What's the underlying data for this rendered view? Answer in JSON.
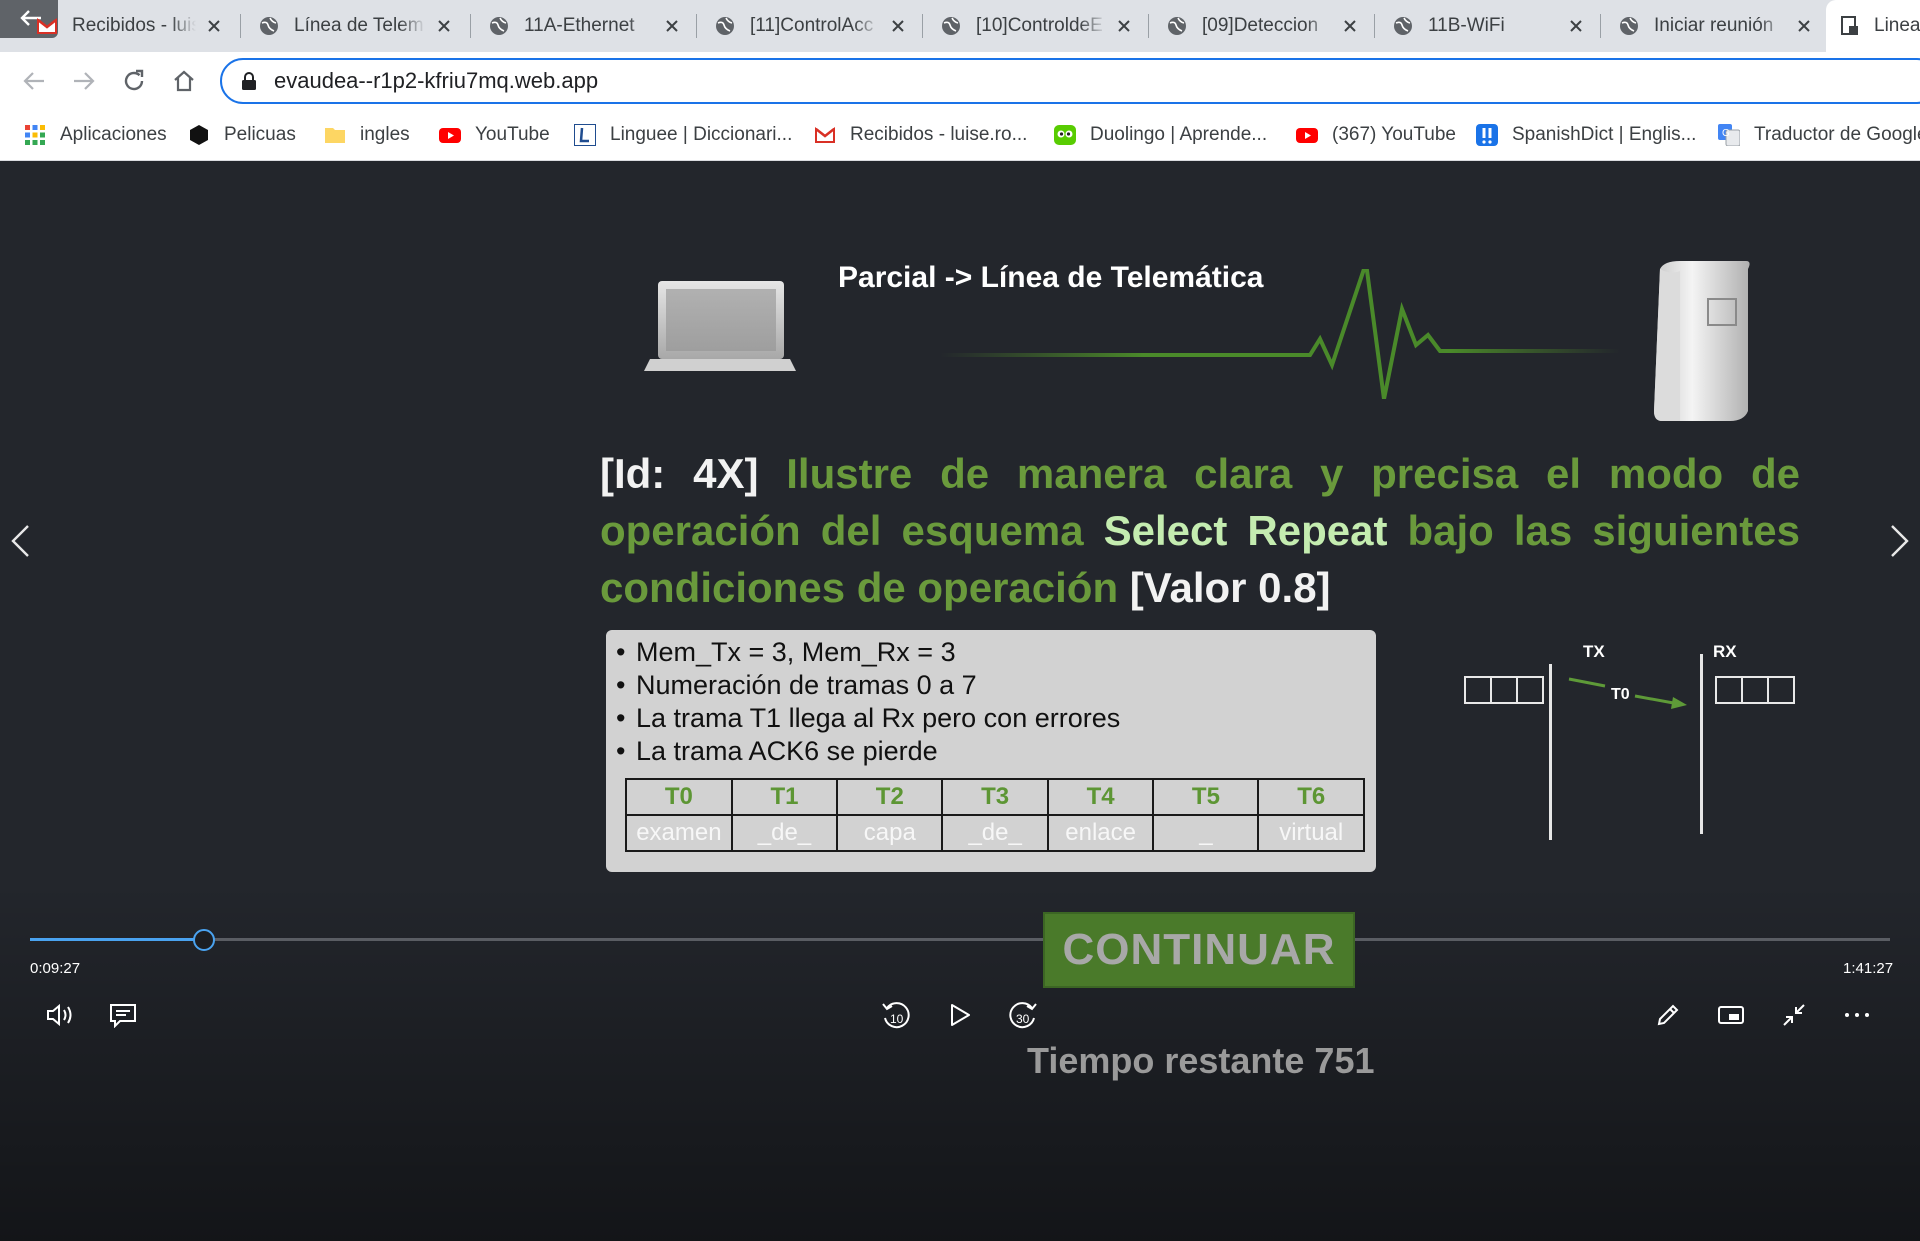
{
  "browser": {
    "tabs": [
      {
        "title": "Recibidos - luis",
        "icon": "gmail-icon"
      },
      {
        "title": "Línea de Telem",
        "icon": "globe-icon"
      },
      {
        "title": "11A-Ethernet",
        "icon": "globe-icon"
      },
      {
        "title": "[11]ControlAcc",
        "icon": "globe-icon"
      },
      {
        "title": "[10]ControldeE",
        "icon": "globe-icon"
      },
      {
        "title": "[09]Deteccion",
        "icon": "globe-icon"
      },
      {
        "title": "11B-WiFi",
        "icon": "globe-icon"
      },
      {
        "title": "Iniciar reunión",
        "icon": "globe-icon"
      },
      {
        "title": "Linea",
        "icon": "page-icon"
      }
    ],
    "url": "evaudea--r1p2-kfriu7mq.web.app",
    "bookmarks": [
      {
        "label": "Aplicaciones",
        "icon": "apps-grid-icon"
      },
      {
        "label": "Pelicuas",
        "icon": "hexagon-icon"
      },
      {
        "label": "ingles",
        "icon": "folder-icon"
      },
      {
        "label": "YouTube",
        "icon": "youtube-icon"
      },
      {
        "label": "Linguee | Diccionari...",
        "icon": "linguee-icon"
      },
      {
        "label": "Recibidos - luise.ro...",
        "icon": "gmail-icon"
      },
      {
        "label": "Duolingo | Aprende...",
        "icon": "duolingo-icon"
      },
      {
        "label": "(367) YouTube",
        "icon": "youtube-icon"
      },
      {
        "label": "SpanishDict | Englis...",
        "icon": "spanishdict-icon"
      },
      {
        "label": "Traductor de Google",
        "icon": "google-translate-icon"
      }
    ]
  },
  "slide": {
    "header_title": "Parcial -> Línea de Telemática",
    "question": {
      "id": "[Id: 4X]",
      "text_a": "Ilustre de manera clara y precisa el modo de operación del esquema",
      "highlight": "Select Repeat",
      "text_b": "bajo las siguientes condiciones de operación",
      "value": "[Valor 0.8]"
    },
    "conditions": [
      "Mem_Tx = 3, Mem_Rx = 3",
      "Numeración de tramas 0 a 7",
      "La trama T1 llega al Rx pero con errores",
      "La trama ACK6 se pierde"
    ],
    "frames_table": {
      "headers": [
        "T0",
        "T1",
        "T2",
        "T3",
        "T4",
        "T5",
        "T6"
      ],
      "values": [
        "examen",
        "_de_",
        "capa",
        "_de_",
        "enlace",
        "_",
        "virtual"
      ]
    },
    "diagram": {
      "tx_label": "TX",
      "rx_label": "RX",
      "frame_label": "T0"
    },
    "continue_label": "CONTINUAR",
    "remaining_label": "Tiempo restante 751"
  },
  "player": {
    "current_time": "0:09:27",
    "total_time": "1:41:27",
    "progress_fraction": 0.0934,
    "accent_color": "#4aa3f0"
  }
}
